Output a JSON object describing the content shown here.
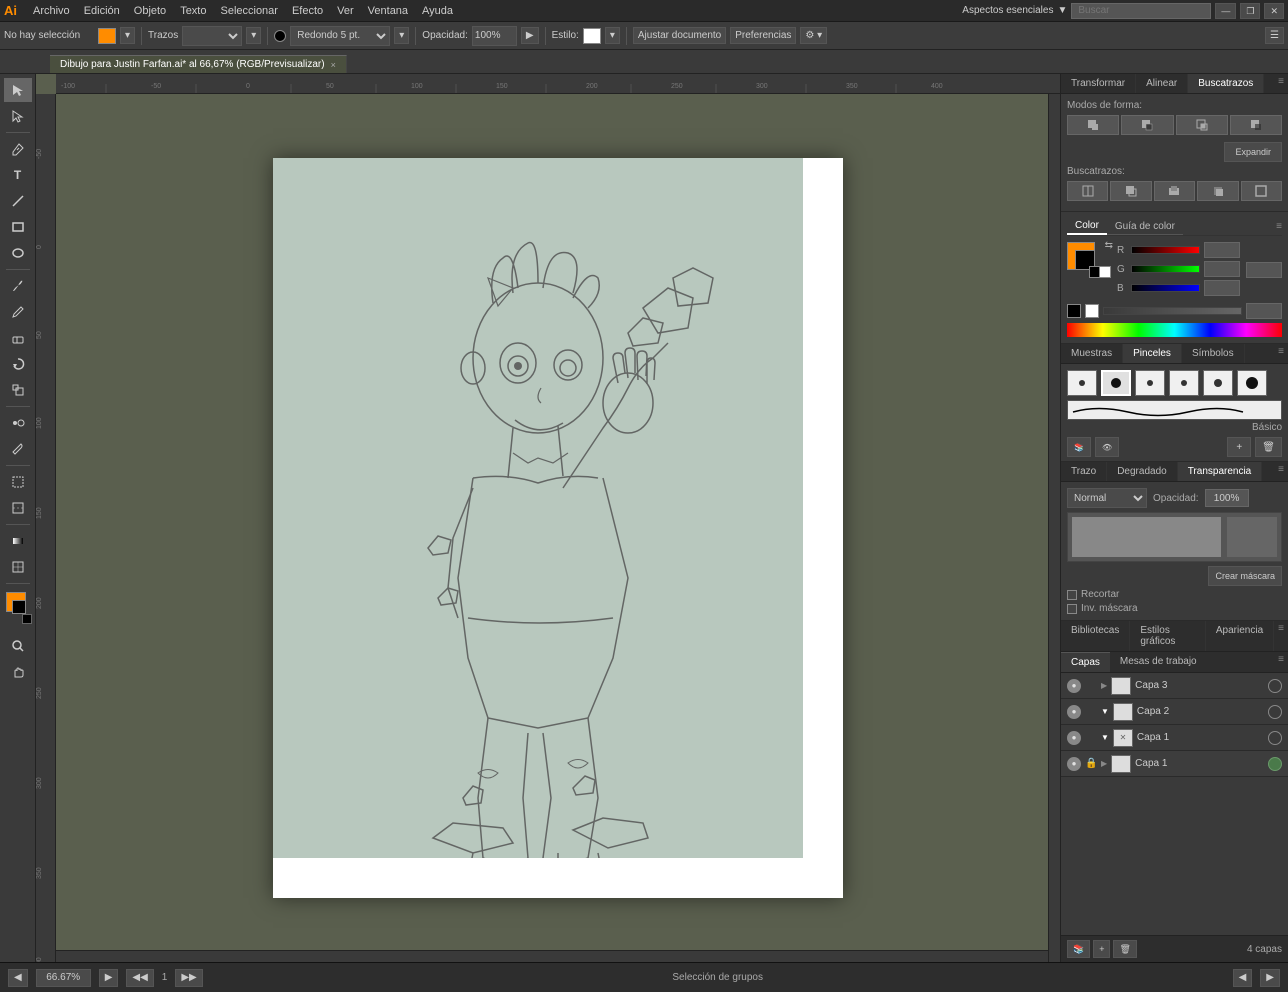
{
  "app": {
    "logo": "Ai",
    "title": "Adobe Illustrator"
  },
  "menu": {
    "items": [
      "Archivo",
      "Edición",
      "Objeto",
      "Texto",
      "Seleccionar",
      "Efecto",
      "Ver",
      "Ventana",
      "Ayuda"
    ]
  },
  "toolbar2": {
    "selection_label": "No hay selección",
    "trazos_label": "Trazos",
    "brush_label": "Redondo 5 pt.",
    "opacity_label": "Opacidad:",
    "opacity_value": "100%",
    "style_label": "Estilo:",
    "adjust_btn": "Ajustar documento",
    "prefs_btn": "Preferencias",
    "workspace_label": "Aspectos esenciales"
  },
  "tab": {
    "title": "Dibujo para Justin Farfan.ai* al 66,67% (RGB/Previsualizar)",
    "close": "×"
  },
  "panels": {
    "right_tabs": [
      "Transformar",
      "Alinear",
      "Buscatrazos"
    ],
    "active_tab": "Buscatrazos",
    "pathfinder": {
      "shape_modes_label": "Modos de forma:",
      "pathfinder_label": "Buscatrazos:",
      "expand_btn": "Expandir"
    },
    "color_tabs": [
      "Color",
      "Guía de color"
    ],
    "color": {
      "r_label": "R",
      "g_label": "G",
      "b_label": "B"
    },
    "brushes_tabs": [
      "Muestras",
      "Pinceles",
      "Símbolos"
    ],
    "brushes": {
      "active_tab": "Pinceles",
      "label": "Básico"
    },
    "transparency_tabs": [
      "Trazo",
      "Degradado",
      "Transparencia"
    ],
    "transparency": {
      "active_tab": "Transparencia",
      "mode_label": "Normal",
      "opacity_label": "Opacidad:",
      "opacity_value": "100%",
      "create_mask_btn": "Crear máscara",
      "cut_btn": "Recortar",
      "invert_btn": "Inv. máscara"
    },
    "layers_tabs": [
      "Bibliotecas",
      "Estilos gráficos",
      "Apariencia"
    ],
    "layers": {
      "tabs": [
        "Capas",
        "Mesas de trabajo"
      ],
      "active_tab": "Capas",
      "items": [
        {
          "name": "Capa 3",
          "visible": true,
          "locked": false,
          "expanded": false
        },
        {
          "name": "Capa 2",
          "visible": true,
          "locked": false,
          "expanded": true
        },
        {
          "name": "Capa 1",
          "visible": true,
          "locked": false,
          "expanded": true,
          "has_lock_icon": true
        },
        {
          "name": "Capa 1",
          "visible": true,
          "locked": true,
          "expanded": false
        }
      ],
      "count_label": "4 capas"
    }
  },
  "status": {
    "zoom_value": "66.67%",
    "artboard_label": "1",
    "selection_label": "Selección de grupos"
  },
  "canvas": {
    "bg_color": "#5a5f4e",
    "artboard_color": "white",
    "sketch_color": "#b8c8c0"
  }
}
